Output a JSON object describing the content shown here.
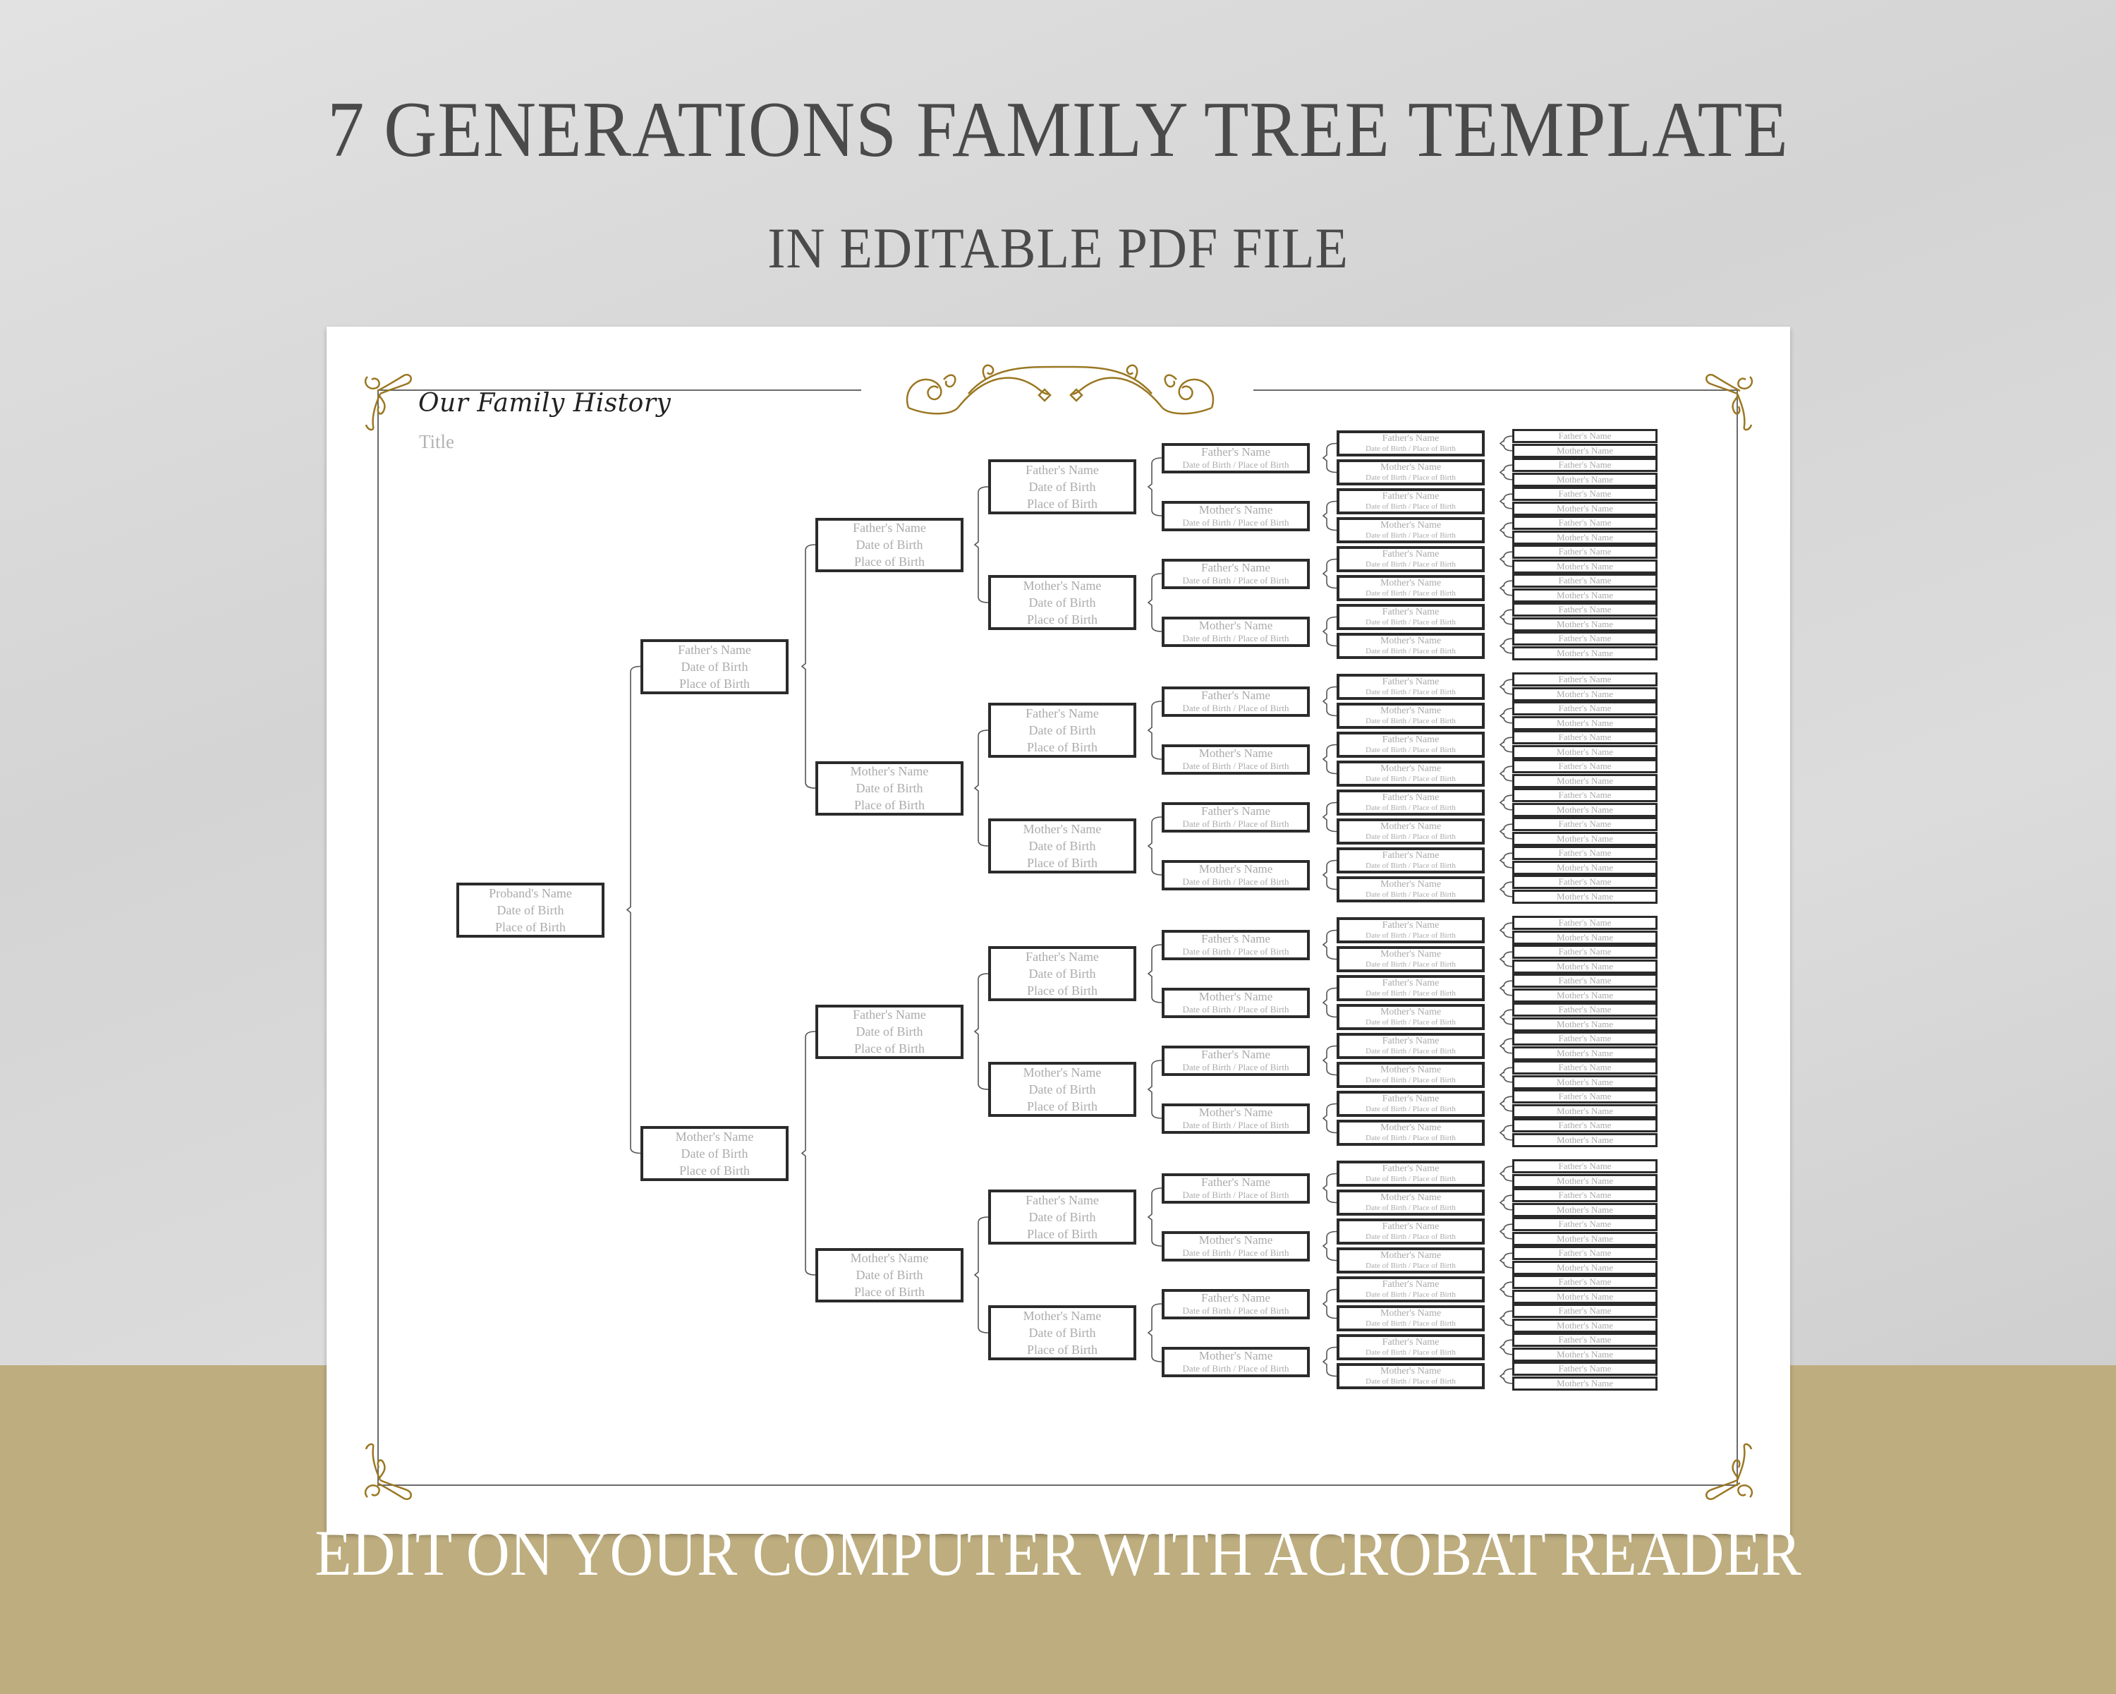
{
  "banner": {
    "title": "7 GENERATIONS FAMILY TREE TEMPLATE",
    "subtitle": "IN EDITABLE PDF FILE",
    "caption": "EDIT ON YOUR COMPUTER WITH ACROBAT READER"
  },
  "colors": {
    "gold_band": "#bead7e",
    "ornament_gold": "#9a7722",
    "box_border": "#2b2b2b",
    "placeholder_text": "#ababab",
    "headline_text": "#4a4a4a"
  },
  "document": {
    "script_title": "Our Family History",
    "title_placeholder": "Title",
    "ornaments": [
      "corner-flourish-top-left",
      "center-scroll-ornament",
      "corner-flourish-top-right",
      "corner-flourish-bottom-left",
      "corner-flourish-bottom-right"
    ]
  },
  "tree": {
    "generations": 7,
    "labels": {
      "proband": "Proband's Name",
      "father": "Father's Name",
      "mother": "Mother's Name",
      "dob": "Date of Birth",
      "pob": "Place of Birth",
      "dob_pob": "Date of Birth / Place of Birth"
    },
    "box_counts": [
      1,
      2,
      4,
      8,
      16,
      32,
      64
    ]
  }
}
